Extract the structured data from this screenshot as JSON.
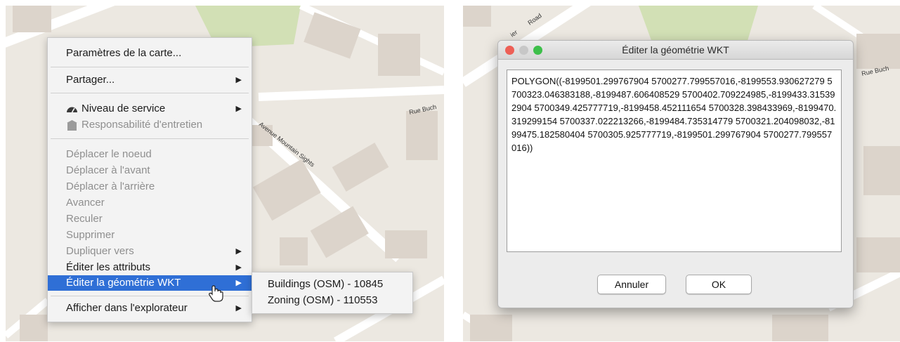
{
  "context_menu": {
    "items": [
      {
        "label": "Paramètres de la carte..."
      },
      {
        "label": "Partager...",
        "submenu_arrow": "▶"
      },
      {
        "label": "Niveau de service",
        "icon": "service-level-icon",
        "submenu_arrow": "▶"
      },
      {
        "label": "Responsabilité d'entretien",
        "icon": "maintenance-icon",
        "disabled": true
      },
      {
        "label": "Déplacer le noeud",
        "disabled": true
      },
      {
        "label": "Déplacer à l'avant",
        "disabled": true
      },
      {
        "label": "Déplacer à l'arrière",
        "disabled": true
      },
      {
        "label": "Avancer",
        "disabled": true
      },
      {
        "label": "Reculer",
        "disabled": true
      },
      {
        "label": "Supprimer",
        "disabled": true
      },
      {
        "label": "Dupliquer vers",
        "disabled": true,
        "submenu_arrow": "▶"
      },
      {
        "label": "Éditer les attributs",
        "submenu_arrow": "▶"
      },
      {
        "label": "Éditer la géométrie WKT",
        "selected": true,
        "submenu_arrow": "▶"
      },
      {
        "label": "Afficher dans l'explorateur",
        "submenu_arrow": "▶"
      }
    ],
    "submenu": [
      {
        "label": "Buildings (OSM) - 10845"
      },
      {
        "label": "Zoning (OSM) - 110553"
      }
    ]
  },
  "map_labels": {
    "left": {
      "street_1": "Rue Buch",
      "street_2": "Avenue Mountain Sights"
    },
    "right": {
      "street_1": "Rue Buch",
      "street_2": "Road",
      "street_2_prefix": "ier"
    }
  },
  "dialog": {
    "title": "Éditer la géométrie WKT",
    "wkt_text": "POLYGON((-8199501.299767904 5700277.799557016,-8199553.930627279 5700323.046383188,-8199487.606408529 5700402.709224985,-8199433.315392904 5700349.425777719,-8199458.452111654 5700328.398433969,-8199470.319299154 5700337.022213266,-8199484.735314779 5700321.204098032,-8199475.182580404 5700305.925777719,-8199501.299767904 5700277.799557016))",
    "cancel_label": "Annuler",
    "ok_label": "OK",
    "traffic_light_colors": {
      "close": "#ed5f56",
      "minimize": "#c7c7c7",
      "zoom": "#3dbf4a"
    }
  },
  "colors": {
    "selection": "#2f6fd6",
    "map_background": "#ece8e1",
    "park": "#d2e0b5",
    "building": "#dcd4cb"
  }
}
